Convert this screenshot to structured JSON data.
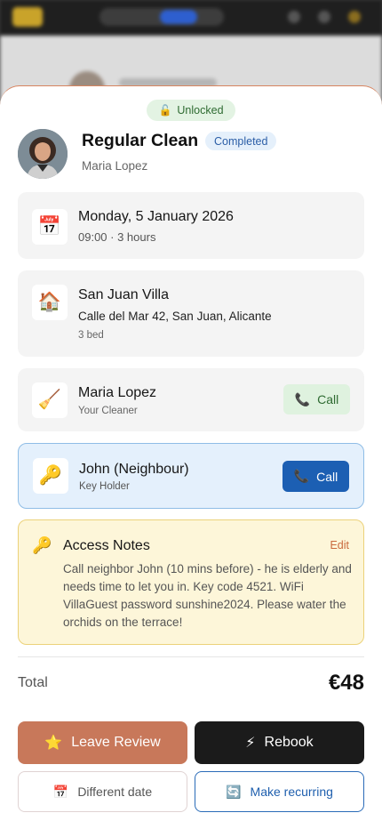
{
  "sheet": {
    "unlock_badge": {
      "icon": "lock-icon",
      "label": "Unlocked"
    },
    "header": {
      "title": "Regular Clean",
      "status": "Completed",
      "subtitle": "Maria Lopez"
    },
    "schedule": {
      "icon": "calendar-icon",
      "date": "Monday, 5 January 2026",
      "time": "09:00 · 3 hours"
    },
    "property": {
      "icon": "house-icon",
      "name": "San Juan Villa",
      "address": "Calle del Mar 42, San Juan, Alicante",
      "size": "3 bed"
    },
    "cleaner": {
      "icon": "broom-icon",
      "name": "Maria Lopez",
      "role": "Your Cleaner",
      "call_label": "Call"
    },
    "key_holder": {
      "icon": "key-icon",
      "name": "John (Neighbour)",
      "role": "Key Holder",
      "call_label": "Call"
    },
    "access_notes": {
      "icon": "key-icon",
      "title": "Access Notes",
      "edit_label": "Edit",
      "body": "Call neighbor John (10 mins before) - he is elderly and needs time to let you in. Key code 4521. WiFi VillaGuest password sunshine2024. Please water the orchids on the terrace!"
    },
    "total": {
      "label": "Total",
      "value": "€48"
    },
    "actions": {
      "leave_review": "Leave Review",
      "rebook": "Rebook",
      "different_date": "Different date",
      "make_recurring": "Make recurring"
    }
  },
  "colors": {
    "accent": "#c8785a",
    "status_blue": "#2b5ea7",
    "success_green": "#2f6b32",
    "notes_bg": "#fdf6d9"
  }
}
